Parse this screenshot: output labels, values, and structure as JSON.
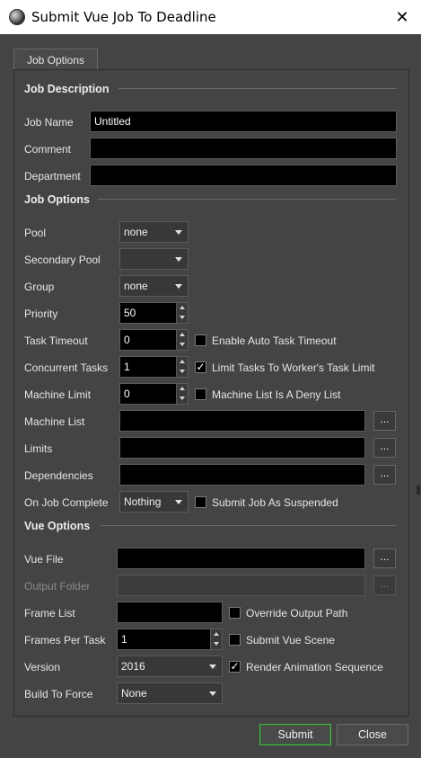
{
  "window": {
    "title": "Submit Vue Job To Deadline"
  },
  "tab": {
    "label": "Job Options"
  },
  "sections": {
    "job_description": "Job Description",
    "job_options": "Job Options",
    "vue_options": "Vue Options"
  },
  "job_description": {
    "job_name_label": "Job Name",
    "job_name_value": "Untitled",
    "comment_label": "Comment",
    "comment_value": "",
    "department_label": "Department",
    "department_value": ""
  },
  "job_options": {
    "pool_label": "Pool",
    "pool_value": "none",
    "secondary_pool_label": "Secondary Pool",
    "secondary_pool_value": "",
    "group_label": "Group",
    "group_value": "none",
    "priority_label": "Priority",
    "priority_value": "50",
    "task_timeout_label": "Task Timeout",
    "task_timeout_value": "0",
    "auto_task_timeout_label": "Enable Auto Task Timeout",
    "auto_task_timeout_checked": false,
    "concurrent_tasks_label": "Concurrent Tasks",
    "concurrent_tasks_value": "1",
    "limit_tasks_label": "Limit Tasks To Worker's Task Limit",
    "limit_tasks_checked": true,
    "machine_limit_label": "Machine Limit",
    "machine_limit_value": "0",
    "deny_list_label": "Machine List Is A Deny List",
    "deny_list_checked": false,
    "machine_list_label": "Machine List",
    "machine_list_value": "",
    "limits_label": "Limits",
    "limits_value": "",
    "dependencies_label": "Dependencies",
    "dependencies_value": "",
    "on_job_complete_label": "On Job Complete",
    "on_job_complete_value": "Nothing",
    "submit_suspended_label": "Submit Job As Suspended",
    "submit_suspended_checked": false
  },
  "vue_options": {
    "vue_file_label": "Vue File",
    "vue_file_value": "",
    "output_folder_label": "Output Folder",
    "output_folder_value": "",
    "frame_list_label": "Frame List",
    "frame_list_value": "",
    "override_output_label": "Override Output Path",
    "override_output_checked": false,
    "frames_per_task_label": "Frames Per Task",
    "frames_per_task_value": "1",
    "submit_scene_label": "Submit Vue Scene",
    "submit_scene_checked": false,
    "version_label": "Version",
    "version_value": "2016",
    "render_animation_label": "Render Animation Sequence",
    "render_animation_checked": true,
    "build_label": "Build To Force",
    "build_value": "None"
  },
  "browse_label": "...",
  "check_mark": "✓",
  "close_glyph": "✕",
  "buttons": {
    "submit": "Submit",
    "close": "Close"
  },
  "colors": {
    "accent_border": "#4bb24b",
    "field_bg": "#000000",
    "panel_bg": "#444444"
  }
}
